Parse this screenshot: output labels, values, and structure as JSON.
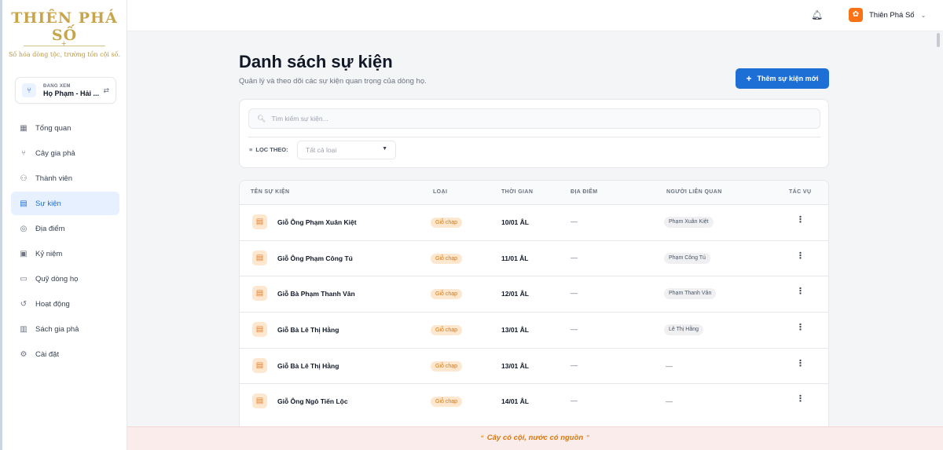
{
  "brand": {
    "logo_title": "THIÊN PHÁ SỐ",
    "slogan": "Số hóa dòng tộc, trường tồn cội số."
  },
  "viewing": {
    "caption": "ĐANG XEM",
    "family_name": "Họ Phạm - Hải ..."
  },
  "sidebar": {
    "items": [
      {
        "label": "Tổng quan",
        "icon": "dashboard-icon"
      },
      {
        "label": "Cây gia phả",
        "icon": "tree-icon"
      },
      {
        "label": "Thành viên",
        "icon": "members-icon"
      },
      {
        "label": "Sự kiện",
        "icon": "calendar-icon",
        "active": true
      },
      {
        "label": "Địa điểm",
        "icon": "location-icon"
      },
      {
        "label": "Kỷ niệm",
        "icon": "memory-icon"
      },
      {
        "label": "Quỹ dòng họ",
        "icon": "fund-icon"
      },
      {
        "label": "Hoạt động",
        "icon": "history-icon"
      },
      {
        "label": "Sách gia phả",
        "icon": "book-icon"
      },
      {
        "label": "Cài đặt",
        "icon": "gear-icon"
      }
    ]
  },
  "topbar": {
    "user_name": "Thiên Phá Số"
  },
  "main": {
    "title": "Danh sách sự kiện",
    "subtitle": "Quản lý và theo dõi các sự kiện quan trọng của dòng họ.",
    "add_button": "Thêm sự kiện mới"
  },
  "filters": {
    "search_placeholder": "Tìm kiếm sự kiện...",
    "filter_label": "LỌC THEO:",
    "type_select": "Tất cả loại"
  },
  "table": {
    "columns": [
      "TÊN SỰ KIỆN",
      "LOẠI",
      "THỜI GIAN",
      "ĐỊA ĐIỂM",
      "NGƯỜI LIÊN QUAN",
      "TÁC VỤ"
    ],
    "rows": [
      {
        "name": "Giỗ Ông Phạm Xuân Kiệt",
        "type": "Giỗ chạp",
        "date": "10/01 ÂL",
        "place": "—",
        "person": "Phạm Xuân Kiệt"
      },
      {
        "name": "Giỗ Ông Phạm Công Tú",
        "type": "Giỗ chạp",
        "date": "11/01 ÂL",
        "place": "—",
        "person": "Phạm Công Tú"
      },
      {
        "name": "Giỗ Bà Phạm Thanh Vân",
        "type": "Giỗ chạp",
        "date": "12/01 ÂL",
        "place": "—",
        "person": "Phạm Thanh Vân"
      },
      {
        "name": "Giỗ Bà Lê Thị Hằng",
        "type": "Giỗ chạp",
        "date": "13/01 ÂL",
        "place": "—",
        "person": "Lê Thị Hằng"
      },
      {
        "name": "Giỗ Bà Lê Thị Hằng",
        "type": "Giỗ chạp",
        "date": "13/01 ÂL",
        "place": "—",
        "person": "—"
      },
      {
        "name": "Giỗ Ông Ngô Tiến Lộc",
        "type": "Giỗ chạp",
        "date": "14/01 ÂL",
        "place": "—",
        "person": "—"
      }
    ]
  },
  "footer": {
    "quote": "Cây có cội, nước có nguồn"
  },
  "colors": {
    "accent": "#1d6fd6",
    "badge_bg": "#fde7cf",
    "badge_text": "#d97706",
    "footer_bg": "#fbecec"
  }
}
